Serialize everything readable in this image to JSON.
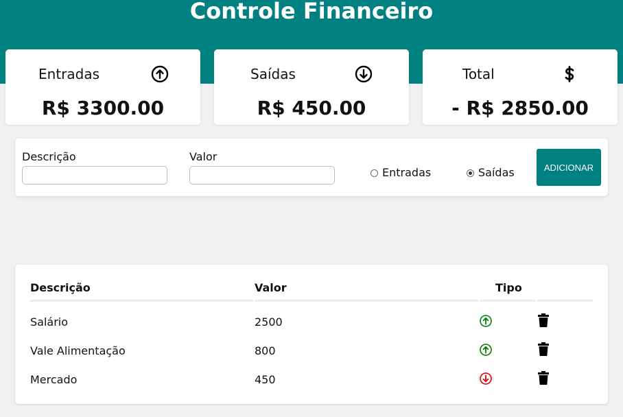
{
  "header": {
    "title": "Controle Financeiro",
    "color": "#008080"
  },
  "summary": {
    "entradas": {
      "label": "Entradas",
      "value": "R$ 3300.00",
      "icon": "arrow-up-circle-icon"
    },
    "saidas": {
      "label": "Saídas",
      "value": "R$ 450.00",
      "icon": "arrow-down-circle-icon"
    },
    "total": {
      "label": "Total",
      "value": "- R$ 2850.00",
      "icon": "dollar-sign-icon"
    }
  },
  "form": {
    "descricao_label": "Descrição",
    "descricao_value": "",
    "valor_label": "Valor",
    "valor_value": "",
    "radio_entradas_label": "Entradas",
    "radio_saidas_label": "Saídas",
    "selected_type": "Saídas",
    "add_button_label": "ADICIONAR"
  },
  "table": {
    "headers": {
      "descricao": "Descrição",
      "valor": "Valor",
      "tipo": "Tipo"
    },
    "rows": [
      {
        "descricao": "Salário",
        "valor": "2500",
        "tipo": "entrada",
        "tipo_icon": "arrow-up-circle-icon",
        "tipo_color": "#008000"
      },
      {
        "descricao": "Vale Alimentação",
        "valor": "800",
        "tipo": "entrada",
        "tipo_icon": "arrow-up-circle-icon",
        "tipo_color": "#008000"
      },
      {
        "descricao": "Mercado",
        "valor": "450",
        "tipo": "saida",
        "tipo_icon": "arrow-down-circle-icon",
        "tipo_color": "#e00000"
      }
    ],
    "delete_icon": "trash-icon"
  }
}
